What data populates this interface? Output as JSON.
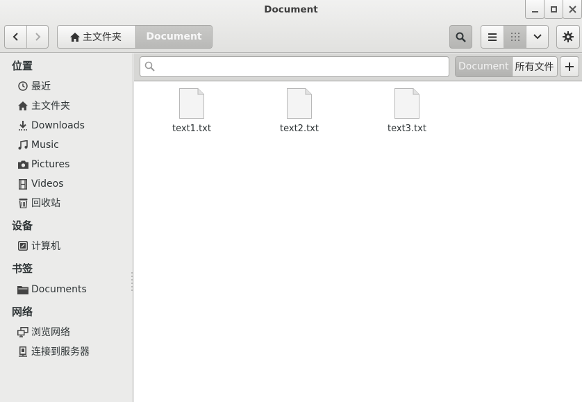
{
  "window": {
    "title": "Document"
  },
  "toolbar": {
    "breadcrumbs": [
      {
        "label": "主文件夹",
        "icon": "home-icon"
      },
      {
        "label": "Document",
        "active": true
      }
    ]
  },
  "sidebar": {
    "sections": [
      {
        "title": "位置",
        "items": [
          {
            "label": "最近",
            "icon": "clock-icon"
          },
          {
            "label": "主文件夹",
            "icon": "home-icon"
          },
          {
            "label": "Downloads",
            "icon": "download-icon"
          },
          {
            "label": "Music",
            "icon": "music-icon"
          },
          {
            "label": "Pictures",
            "icon": "camera-icon"
          },
          {
            "label": "Videos",
            "icon": "film-icon"
          },
          {
            "label": "回收站",
            "icon": "trash-icon"
          }
        ]
      },
      {
        "title": "设备",
        "items": [
          {
            "label": "计算机",
            "icon": "computer-icon"
          }
        ]
      },
      {
        "title": "书签",
        "items": [
          {
            "label": "Documents",
            "icon": "folder-icon"
          }
        ]
      },
      {
        "title": "网络",
        "items": [
          {
            "label": "浏览网络",
            "icon": "network-icon"
          },
          {
            "label": "连接到服务器",
            "icon": "server-icon"
          }
        ]
      }
    ]
  },
  "search": {
    "value": "",
    "placeholder": ""
  },
  "scope": {
    "current": "Document",
    "all": "所有文件"
  },
  "files": [
    {
      "name": "text1.txt"
    },
    {
      "name": "text2.txt"
    },
    {
      "name": "text3.txt"
    }
  ]
}
